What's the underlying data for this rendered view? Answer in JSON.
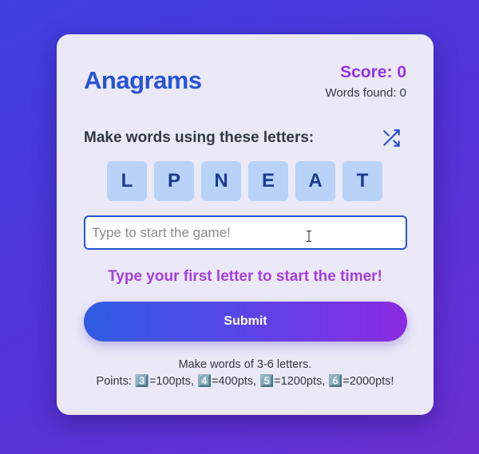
{
  "header": {
    "title": "Anagrams",
    "score_label": "Score: 0",
    "words_found_label": "Words found: 0"
  },
  "game": {
    "instructions": "Make words using these letters:",
    "shuffle_icon": "shuffle-icon",
    "letters": [
      "L",
      "P",
      "N",
      "E",
      "A",
      "T"
    ],
    "input_placeholder": "Type to start the game!",
    "input_value": "",
    "timer_message": "Type your first letter to start the timer!",
    "submit_label": "Submit"
  },
  "footer": {
    "rule_line": "Make words of 3-6 letters.",
    "points_line": "Points: 3️⃣=100pts, 4️⃣=400pts, 5️⃣=1200pts, 6️⃣=2000pts!"
  },
  "colors": {
    "title": "#2754d6",
    "score": "#9333ea",
    "tile_bg": "#b8d2f8",
    "timer_message": "#a43ee0"
  }
}
